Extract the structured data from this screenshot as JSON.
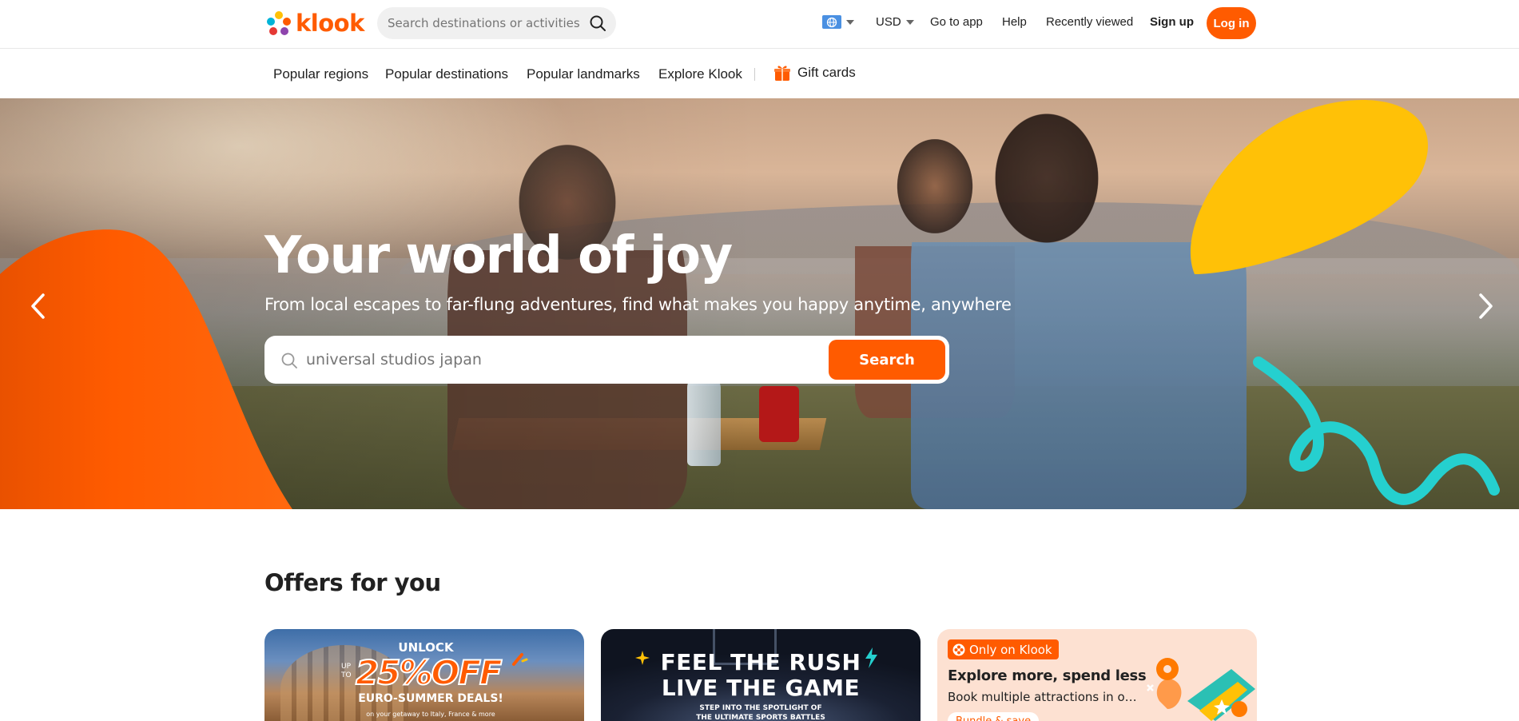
{
  "header": {
    "logo_text": "klook",
    "search_placeholder": "Search destinations or activities",
    "currency": "USD",
    "links": {
      "go_to_app": "Go to app",
      "help": "Help",
      "recently_viewed": "Recently viewed",
      "sign_up": "Sign up"
    },
    "login_label": "Log in"
  },
  "subnav": {
    "items": [
      "Popular regions",
      "Popular destinations",
      "Popular landmarks",
      "Explore Klook"
    ],
    "gift_cards": "Gift cards"
  },
  "hero": {
    "title": "Your world of joy",
    "subtitle": "From local escapes to far-flung adventures, find what makes you happy anytime, anywhere",
    "search_placeholder": "universal studios japan",
    "search_button": "Search"
  },
  "offers": {
    "title": "Offers for you",
    "cards": [
      {
        "unlock": "UNLOCK",
        "upto": "UP TO",
        "discount": "25%OFF",
        "headline": "EURO-SUMMER DEALS!",
        "note": "on your getaway to Italy, France & more"
      },
      {
        "line1": "FEEL THE RUSH",
        "line2": "LIVE THE GAME",
        "line3": "STEP INTO THE SPOTLIGHT OF",
        "line4": "THE ULTIMATE SPORTS BATTLES"
      },
      {
        "badge": "Only on Klook",
        "title": "Explore more, spend less",
        "subtitle": "Book multiple attractions in on...",
        "pill": "Bundle & save"
      }
    ]
  },
  "colors": {
    "brand": "#ff5b00",
    "accent_yellow": "#ffc107",
    "accent_teal": "#25d0cf"
  }
}
